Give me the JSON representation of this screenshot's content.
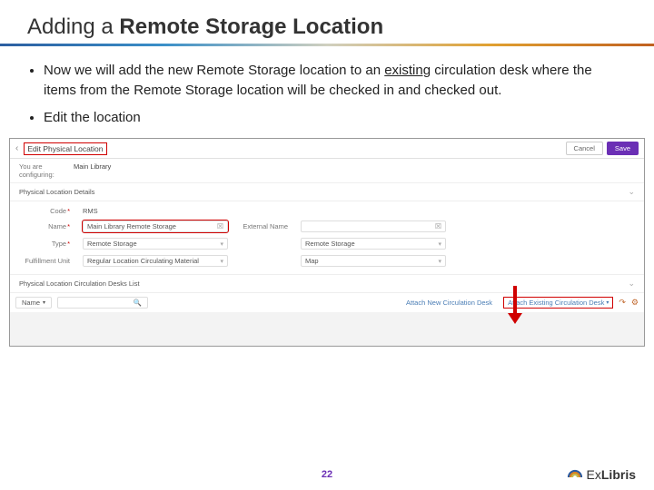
{
  "slide": {
    "title_prefix": "Adding a ",
    "title_bold": "Remote Storage Location",
    "bullet1a": "Now we will add the new Remote Storage location to an ",
    "bullet1b_underlined": "existing",
    "bullet1c": " circulation desk where the items from the Remote Storage location will be checked in and checked out.",
    "bullet2": "Edit the location",
    "page_number": "22"
  },
  "shot": {
    "page_title": "Edit Physical Location",
    "cancel": "Cancel",
    "save": "Save",
    "config_label": "You are configuring:",
    "config_value": "Main Library",
    "details_panel": "Physical Location Details",
    "desks_panel": "Physical Location Circulation Desks List",
    "fields": {
      "code_label": "Code",
      "code_value": "RMS",
      "name_label": "Name",
      "name_value": "Main Library Remote Storage",
      "type_label": "Type",
      "type_value": "Remote Storage",
      "fulfil_label": "Fulfillment Unit",
      "fulfil_value": "Regular Location Circulating Material",
      "external_label": "External Name",
      "external_value": "",
      "rs_label": "",
      "rs_value": "Remote Storage",
      "map_label": "",
      "map_value": "Map"
    },
    "desks": {
      "name_dd": "Name",
      "attach_new": "Attach New Circulation Desk",
      "attach_existing": "Attach Existing Circulation Desk"
    }
  },
  "logo": {
    "light": "Ex",
    "bold": "Libris"
  }
}
